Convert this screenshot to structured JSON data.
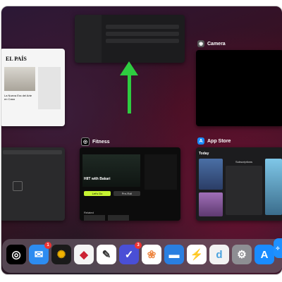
{
  "cards": {
    "camera": {
      "label": "Camera"
    },
    "fitness": {
      "label": "Fitness",
      "workout_title": "HIIT with Bakari",
      "section": "Related",
      "button_left": "Let's Go",
      "button_right": "Pre-Roll"
    },
    "appstore": {
      "label": "App Store",
      "header": "Today",
      "sidebar_title": "Subscriptions"
    },
    "elpais": {
      "masthead": "EL PAÍS",
      "headline": "La Nueva Era del Arte en Casa"
    }
  },
  "dock": {
    "badges": {
      "mail": "1",
      "reminders": "3"
    },
    "files_label": "d"
  },
  "colors": {
    "arrow": "#2ecc40",
    "fitness_accent": "#c6f432",
    "badge": "#e33333"
  }
}
